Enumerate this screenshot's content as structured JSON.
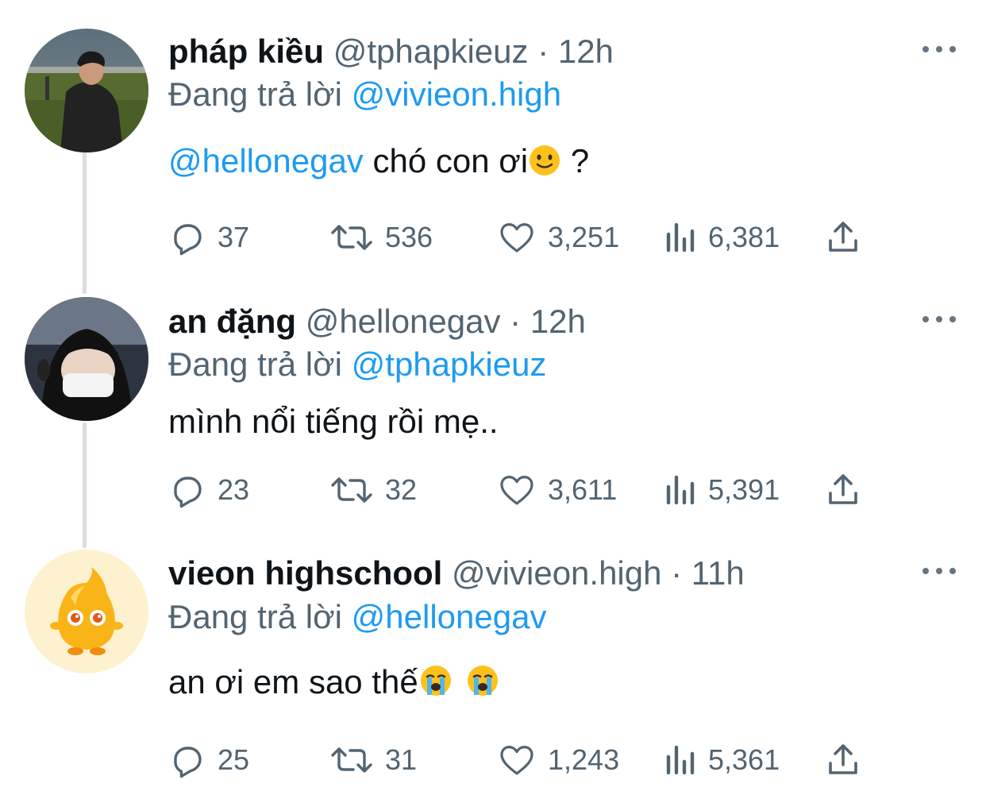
{
  "tweets": [
    {
      "name": "pháp kiều",
      "handle": "@tphapkieuz",
      "time": "· 12h",
      "reply_prefix": "Đang trả lời",
      "reply_to": "@vivieon.high",
      "body_mention": "@hellonegav",
      "body_text": " chó con ơi",
      "body_tail": " ?",
      "emoji": "slightly-smiling-face",
      "counts": {
        "reply": "37",
        "retweet": "536",
        "like": "3,251",
        "views": "6,381"
      }
    },
    {
      "name": "an đặng",
      "handle": "@hellonegav",
      "time": "· 12h",
      "reply_prefix": "Đang trả lời",
      "reply_to": "@tphapkieuz",
      "body_text": "mình nổi tiếng rồi mẹ..",
      "counts": {
        "reply": "23",
        "retweet": "32",
        "like": "3,611",
        "views": "5,391"
      }
    },
    {
      "name": "vieon highschool",
      "handle": "@vivieon.high",
      "time": "· 11h",
      "reply_prefix": "Đang trả lời",
      "reply_to": "@hellonegav",
      "body_text": "an ơi em sao thế",
      "emoji": "loudly-crying-face",
      "counts": {
        "reply": "25",
        "retweet": "31",
        "like": "1,243",
        "views": "5,361"
      }
    }
  ],
  "colors": {
    "link": "#1d9bf0",
    "muted": "#536471",
    "text": "#0f1419",
    "thread_line": "#d9dde1"
  }
}
